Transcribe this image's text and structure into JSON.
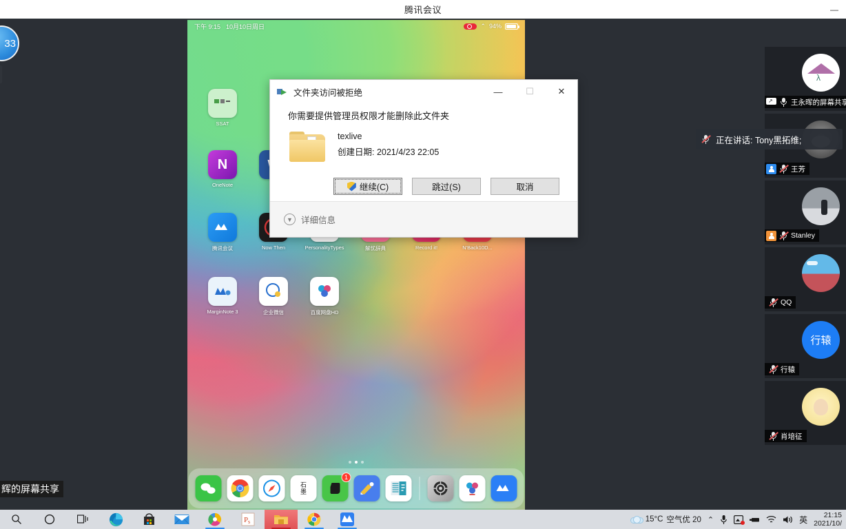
{
  "window": {
    "title": "腾讯会议",
    "minimize_label": "—"
  },
  "meeting": {
    "float_avatar_text": "33",
    "float_label": "中",
    "bottom_share_label": "辉的屏幕共享",
    "speaking_toast": {
      "text": "正在讲话: Tony黑拓维;",
      "mic_icon": "mic-muted-icon"
    },
    "participants": [
      {
        "name": "王永晖的屏幕共享",
        "avatar": "triangle-logo-avatar",
        "mic": "mic-on-icon",
        "badge_icon": "screen-share-icon",
        "badge_color": "#ffffff",
        "muted": false
      },
      {
        "name": "王芳",
        "avatar": "totoro-avatar",
        "mic": "mic-muted-icon",
        "badge_icon": "person-icon",
        "badge_color": "#2d8cf0",
        "muted": true
      },
      {
        "name": "Stanley",
        "avatar": "snow-photo-avatar",
        "mic": "mic-muted-icon",
        "badge_icon": "person-icon",
        "badge_color": "#f29339",
        "muted": true
      },
      {
        "name": "QQ",
        "avatar": "field-photo-avatar",
        "mic": "mic-muted-icon",
        "badge_icon": "none",
        "badge_color": "",
        "muted": true
      },
      {
        "name": "行辕",
        "avatar": "blue-text-avatar",
        "avatar_text": "行辕",
        "mic": "mic-muted-icon",
        "badge_icon": "none",
        "badge_color": "",
        "muted": true
      },
      {
        "name": "肖培征",
        "avatar": "baby-avatar",
        "mic": "mic-muted-icon",
        "badge_icon": "none",
        "badge_color": "",
        "muted": true
      }
    ]
  },
  "dialog": {
    "title": "文件夹访问被拒绝",
    "title_icon": "folder-shield-icon",
    "minimize_label": "—",
    "maximize_label": "☐",
    "close_label": "✕",
    "message": "你需要提供管理员权限才能删除此文件夹",
    "folder_icon": "folder-icon",
    "item_name": "texlive",
    "item_date": "创建日期: 2021/4/23 22:05",
    "buttons": [
      {
        "label": "继续(C)",
        "icon": "uac-shield-icon",
        "focused": true
      },
      {
        "label": "跳过(S)",
        "icon": "",
        "focused": false
      },
      {
        "label": "取消",
        "icon": "",
        "focused": false
      }
    ],
    "footer_label": "详细信息",
    "footer_icon": "chevron-down-icon"
  },
  "ipad": {
    "status": {
      "time": "下午 9:15",
      "date": "10月10日周日",
      "recording_icon": "record-icon",
      "wifi_icon": "wifi-icon",
      "battery_percent": "94%"
    },
    "app_rows": [
      [
        {
          "label": "SSAT",
          "icon_class": "ic-ssat",
          "glyph": ""
        },
        {
          "label": "",
          "icon_class": "",
          "glyph": ""
        },
        {
          "label": "",
          "icon_class": "",
          "glyph": ""
        },
        {
          "label": "",
          "icon_class": "",
          "glyph": ""
        },
        {
          "label": "",
          "icon_class": "",
          "glyph": ""
        },
        {
          "label": "",
          "icon_class": "",
          "glyph": ""
        }
      ],
      [
        {
          "label": "OneNote",
          "icon_class": "ic-onenote",
          "glyph": "N"
        },
        {
          "label": "W",
          "icon_class": "ic-word",
          "glyph": "W"
        },
        {
          "label": "",
          "icon_class": "",
          "glyph": ""
        },
        {
          "label": "",
          "icon_class": "",
          "glyph": ""
        },
        {
          "label": "",
          "icon_class": "",
          "glyph": ""
        },
        {
          "label": "",
          "icon_class": "",
          "glyph": ""
        }
      ],
      [
        {
          "label": "腾讯会议",
          "icon_class": "ic-vooc",
          "glyph": "M"
        },
        {
          "label": "Now Then",
          "icon_class": "ic-nowthen",
          "glyph": "◉"
        },
        {
          "label": "PersonalityTypes",
          "icon_class": "ic-ptypes",
          "glyph": ""
        },
        {
          "label": "解忧辞典",
          "icon_class": "ic-bili",
          "glyph": "bili"
        },
        {
          "label": "Record it!",
          "icon_class": "ic-record",
          "glyph": "◉"
        },
        {
          "label": "N'Back10D...",
          "icon_class": "ic-nback",
          "glyph": ""
        }
      ],
      [
        {
          "label": "MarginNote 3",
          "icon_class": "ic-margin",
          "glyph": "M"
        },
        {
          "label": "企业微信",
          "icon_class": "ic-wework",
          "glyph": "Q"
        },
        {
          "label": "百度网盘HD",
          "icon_class": "ic-baidu",
          "glyph": ""
        },
        {
          "label": "",
          "icon_class": "",
          "glyph": ""
        },
        {
          "label": "",
          "icon_class": "",
          "glyph": ""
        },
        {
          "label": "",
          "icon_class": "",
          "glyph": ""
        }
      ]
    ],
    "page_dots": 3,
    "active_dot": 1,
    "dock": [
      {
        "name": "wechat-icon",
        "glyph": "",
        "badge": ""
      },
      {
        "name": "chrome-icon",
        "glyph": "",
        "badge": ""
      },
      {
        "name": "safari-icon",
        "glyph": "",
        "badge": ""
      },
      {
        "name": "shimo-icon",
        "glyph": "石墨",
        "badge": ""
      },
      {
        "name": "evernote-icon",
        "glyph": "",
        "badge": "1"
      },
      {
        "name": "notability-icon",
        "glyph": "",
        "badge": ""
      },
      {
        "name": "goodnotes-icon",
        "glyph": "",
        "badge": ""
      },
      {
        "name": "settings-icon",
        "glyph": "",
        "badge": ""
      },
      {
        "name": "baidu-netdisk-icon",
        "glyph": "",
        "badge": ""
      },
      {
        "name": "tencent-meeting-icon",
        "glyph": "",
        "badge": ""
      }
    ]
  },
  "taskbar": {
    "items": [
      {
        "name": "search-icon",
        "glyph": "search",
        "underline": false,
        "active": false
      },
      {
        "name": "cortana-icon",
        "glyph": "circle",
        "underline": false,
        "active": false
      },
      {
        "name": "task-view-icon",
        "glyph": "taskview",
        "underline": false,
        "active": false
      },
      {
        "name": "edge-icon",
        "glyph": "edge",
        "underline": false,
        "active": false
      },
      {
        "name": "microsoft-store-icon",
        "glyph": "store",
        "underline": false,
        "active": false
      },
      {
        "name": "mail-icon",
        "glyph": "mail",
        "underline": false,
        "active": false
      },
      {
        "name": "photos-icon",
        "glyph": "photos",
        "underline": true,
        "active": false
      },
      {
        "name": "powerpoint-icon",
        "glyph": "ppt",
        "underline": false,
        "active": false
      },
      {
        "name": "file-explorer-icon",
        "glyph": "folder",
        "underline": true,
        "active": true
      },
      {
        "name": "chrome-icon",
        "glyph": "chrome",
        "underline": true,
        "active": false
      },
      {
        "name": "tencent-meeting-icon",
        "glyph": "meeting",
        "underline": true,
        "active": false
      }
    ],
    "weather": {
      "icon": "cloud-icon",
      "temperature": "15°C",
      "air_quality": "空气优 20"
    },
    "tray": {
      "expand_icon": "chevron-up-icon",
      "mic_icon": "microphone-icon",
      "screen_icon": "screen-recording-icon",
      "usb_icon": "usb-icon",
      "wifi_icon": "wifi-icon",
      "volume_icon": "volume-icon",
      "ime_label": "英"
    },
    "clock": {
      "time": "21:15",
      "date": "2021/10/"
    }
  }
}
